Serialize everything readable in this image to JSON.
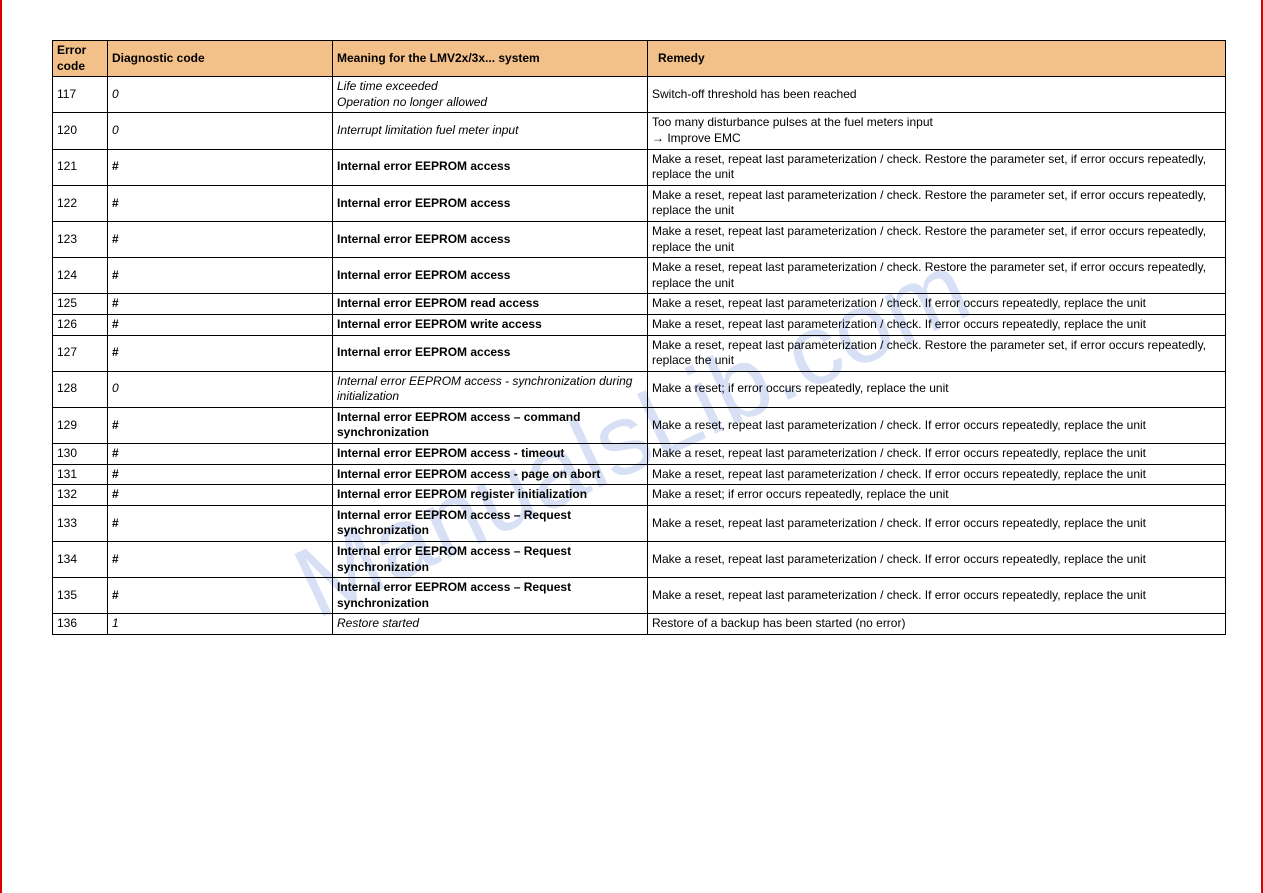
{
  "watermark": "ManualsLib.com",
  "headers": {
    "error_code": "Error code",
    "diagnostic_code": "Diagnostic code",
    "meaning": "Meaning for the LMV2x/3x... system",
    "remedy": "Remedy"
  },
  "rows": [
    {
      "code": "117",
      "diag": "0",
      "diag_style": "italic",
      "meaning_lines": [
        "Life time exceeded",
        "Operation no longer allowed"
      ],
      "meaning_style": "italic",
      "remedy": "Switch-off threshold has been reached"
    },
    {
      "code": "120",
      "diag": "0",
      "diag_style": "italic",
      "meaning_lines": [
        "Interrupt limitation fuel meter input"
      ],
      "meaning_style": "italic",
      "remedy": "Too many disturbance pulses at the fuel meters input\n→ Improve EMC"
    },
    {
      "code": "121",
      "diag": "#",
      "diag_style": "bold",
      "meaning_lines": [
        "Internal error EEPROM access"
      ],
      "meaning_style": "bold",
      "remedy": "Make a reset, repeat last parameterization / check. Restore the parameter set, if error occurs repeatedly, replace the unit"
    },
    {
      "code": "122",
      "diag": "#",
      "diag_style": "bold",
      "meaning_lines": [
        "Internal error EEPROM access"
      ],
      "meaning_style": "bold",
      "remedy": "Make a reset, repeat last parameterization / check. Restore the parameter set, if error occurs repeatedly, replace the unit"
    },
    {
      "code": "123",
      "diag": "#",
      "diag_style": "bold",
      "meaning_lines": [
        "Internal error EEPROM access"
      ],
      "meaning_style": "bold",
      "remedy": "Make a reset, repeat last parameterization / check. Restore the parameter set, if error occurs repeatedly, replace the unit"
    },
    {
      "code": "124",
      "diag": "#",
      "diag_style": "bold",
      "meaning_lines": [
        "Internal error EEPROM access"
      ],
      "meaning_style": "bold",
      "remedy": "Make a reset, repeat last parameterization / check. Restore the parameter set, if error occurs repeatedly, replace the unit"
    },
    {
      "code": "125",
      "diag": "#",
      "diag_style": "bold",
      "meaning_lines": [
        "Internal error EEPROM read access"
      ],
      "meaning_style": "bold",
      "remedy": "Make a reset, repeat last parameterization / check. If error occurs repeatedly, replace the unit"
    },
    {
      "code": "126",
      "diag": "#",
      "diag_style": "bold",
      "meaning_lines": [
        "Internal error EEPROM write access"
      ],
      "meaning_style": "bold",
      "remedy": "Make a reset, repeat last parameterization / check. If error occurs repeatedly, replace the unit"
    },
    {
      "code": "127",
      "diag": "#",
      "diag_style": "bold",
      "meaning_lines": [
        "Internal error EEPROM access"
      ],
      "meaning_style": "bold",
      "remedy": "Make a reset, repeat last parameterization / check. Restore the parameter set, if error occurs repeatedly, replace the unit"
    },
    {
      "code": "128",
      "diag": "0",
      "diag_style": "italic",
      "meaning_lines": [
        "Internal error EEPROM access - synchronization during initialization"
      ],
      "meaning_style": "italic",
      "remedy": "Make a reset; if error occurs repeatedly, replace the unit"
    },
    {
      "code": "129",
      "diag": "#",
      "diag_style": "bold",
      "meaning_lines": [
        "Internal error EEPROM access – command synchronization"
      ],
      "meaning_style": "bold",
      "remedy": "Make a reset, repeat last parameterization / check. If error occurs repeatedly, replace the unit"
    },
    {
      "code": "130",
      "diag": "#",
      "diag_style": "bold",
      "meaning_lines": [
        "Internal error EEPROM access - timeout"
      ],
      "meaning_style": "bold",
      "remedy": "Make a reset, repeat last parameterization / check. If error occurs repeatedly, replace the unit"
    },
    {
      "code": "131",
      "diag": "#",
      "diag_style": "bold",
      "meaning_lines": [
        "Internal error EEPROM access - page on abort"
      ],
      "meaning_style": "bold",
      "remedy": "Make a reset, repeat last parameterization / check. If error occurs repeatedly, replace the unit"
    },
    {
      "code": "132",
      "diag": "#",
      "diag_style": "bold",
      "meaning_lines": [
        "Internal error EEPROM register initialization"
      ],
      "meaning_style": "bold",
      "remedy": "Make a reset; if error occurs repeatedly, replace the unit"
    },
    {
      "code": "133",
      "diag": "#",
      "diag_style": "bold",
      "meaning_lines": [
        "Internal error EEPROM access – Request synchronization"
      ],
      "meaning_style": "bold",
      "remedy": "Make a reset, repeat last parameterization / check. If error occurs repeatedly, replace the unit"
    },
    {
      "code": "134",
      "diag": "#",
      "diag_style": "bold",
      "meaning_lines": [
        "Internal error EEPROM access – Request synchronization"
      ],
      "meaning_style": "bold",
      "remedy": "Make a reset, repeat last parameterization / check. If error occurs repeatedly, replace the unit"
    },
    {
      "code": "135",
      "diag": "#",
      "diag_style": "bold",
      "meaning_lines": [
        "Internal error EEPROM access – Request synchronization"
      ],
      "meaning_style": "bold",
      "remedy": "Make a reset, repeat last parameterization / check. If error occurs repeatedly, replace the unit"
    },
    {
      "code": "136",
      "diag": "1",
      "diag_style": "italic",
      "meaning_lines": [
        "Restore started"
      ],
      "meaning_style": "italic",
      "remedy": "Restore of a backup has been started (no error)"
    }
  ]
}
